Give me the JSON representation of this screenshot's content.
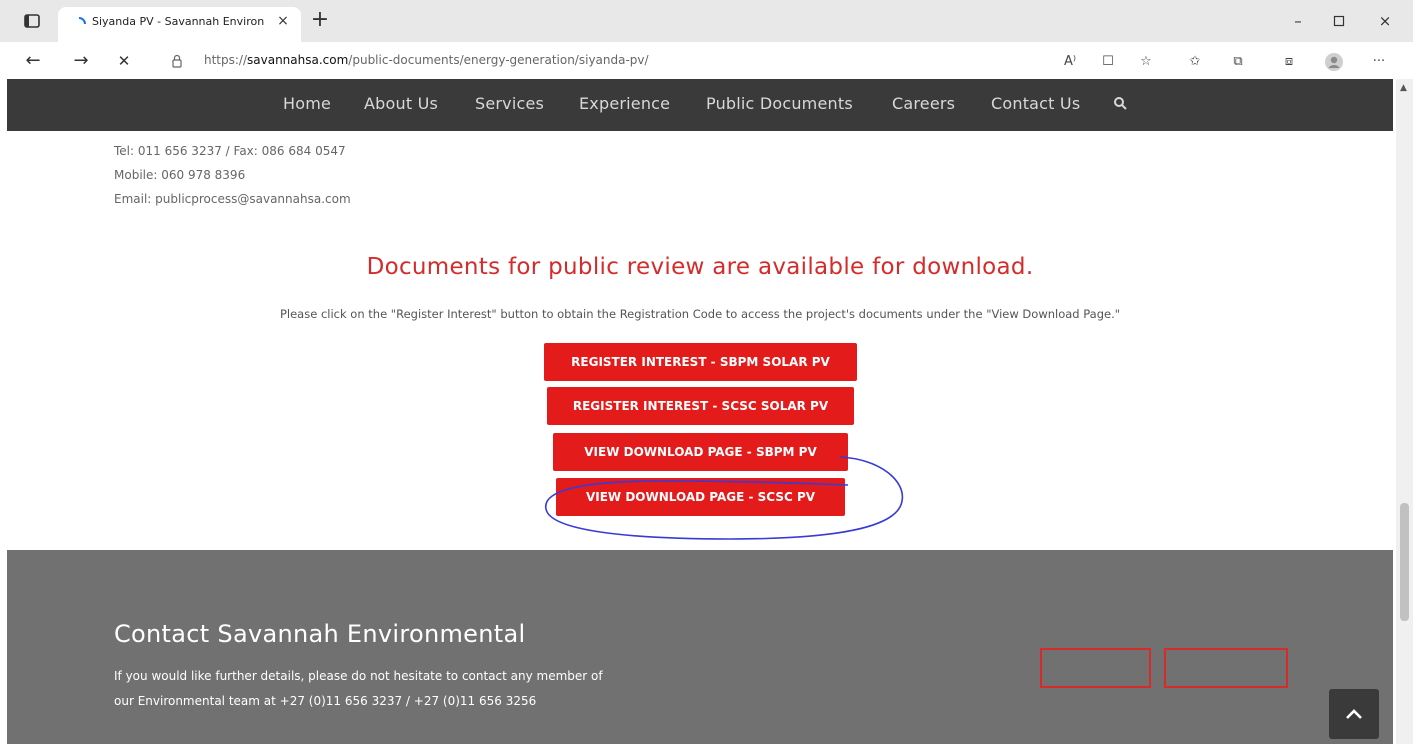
{
  "browser": {
    "tab_title": "Siyanda PV - Savannah Environ",
    "tab_close": "×",
    "new_tab": "+",
    "window_controls": {
      "minimize": "–",
      "maximize": "▫",
      "close": "×"
    },
    "url_prefix": "https://",
    "url_host": "savannahsa.com",
    "url_path": "/public-documents/energy-generation/siyanda-pv/",
    "toolbar_icons": [
      "read-aloud-icon",
      "immersive-reader-icon",
      "add-favorite-icon",
      "favorites-icon",
      "collections-icon",
      "extensions-icon",
      "profile-icon",
      "more-icon"
    ],
    "toolbar_glyphs": {
      "read_aloud": "A⁾",
      "immersive": "☐",
      "fav_add": "☆",
      "favorites": "✩",
      "collections": "⧉",
      "extensions": "⧈",
      "more": "···"
    },
    "nav_glyphs": {
      "back": "←",
      "forward": "→",
      "stop": "✕"
    }
  },
  "site_nav": {
    "items": [
      "Home",
      "About Us",
      "Services",
      "Experience",
      "Public Documents",
      "Careers",
      "Contact Us"
    ],
    "search_icon": "search-icon"
  },
  "contact": {
    "tel_fax": "Tel: 011 656 3237 / Fax: 086 684 0547",
    "mobile": "Mobile: 060 978 8396",
    "email": "Email: publicprocess@savannahsa.com"
  },
  "main": {
    "heading": "Documents for public review are available for download.",
    "instruction": "Please click on the \"Register Interest\" button to obtain the Registration Code to access the project's documents under the \"View Download Page.\"",
    "buttons": [
      "REGISTER INTEREST - SBPM SOLAR PV",
      "REGISTER INTEREST - SCSC SOLAR PV",
      "VIEW DOWNLOAD PAGE - SBPM PV",
      "VIEW DOWNLOAD PAGE - SCSC PV"
    ]
  },
  "footer": {
    "title": "Contact Savannah Environmental",
    "text_line1": "If you would like further details, please do not hesitate to contact any member of",
    "text_line2": "our Environmental team at +27 (0)11 656 3237 / +27 (0)11 656 3256"
  },
  "colors": {
    "accent_red": "#e31b1b",
    "nav_bg": "#3a3a3a",
    "footer_bg": "#717171",
    "annotation_blue": "#3a3ad6"
  }
}
